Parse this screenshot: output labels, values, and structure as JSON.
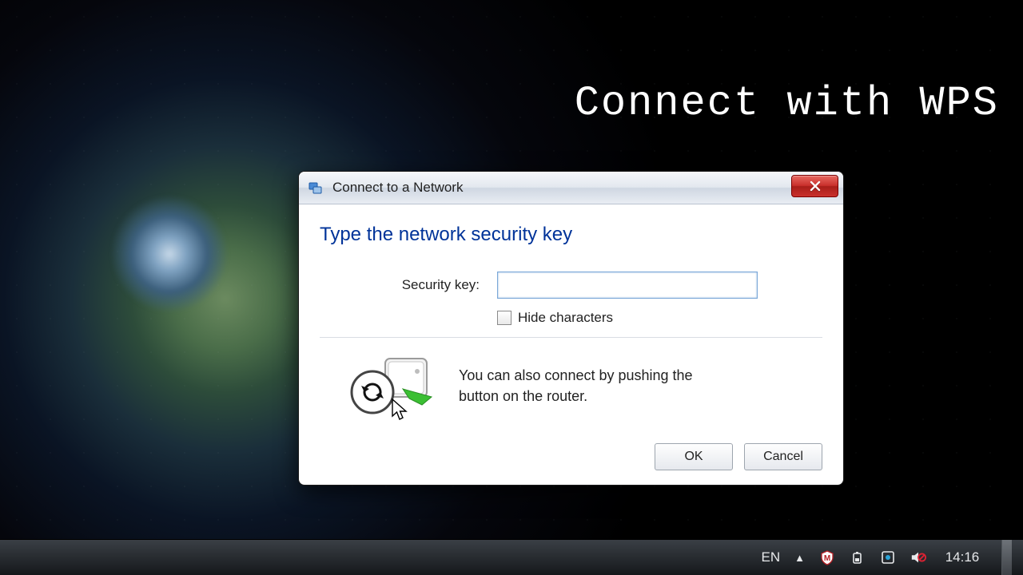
{
  "overlay": {
    "caption": "Connect with WPS"
  },
  "dialog": {
    "title": "Connect to a Network",
    "heading": "Type the network security key",
    "security_key_label": "Security key:",
    "security_key_value": "",
    "hide_chars_label": "Hide characters",
    "hide_chars_checked": false,
    "wps_hint": "You can also connect by pushing the button on the router.",
    "ok_label": "OK",
    "cancel_label": "Cancel"
  },
  "taskbar": {
    "lang": "EN",
    "clock": "14:16",
    "icons": [
      "shield-icon",
      "battery-icon",
      "action-center-icon",
      "volume-muted-icon"
    ]
  }
}
